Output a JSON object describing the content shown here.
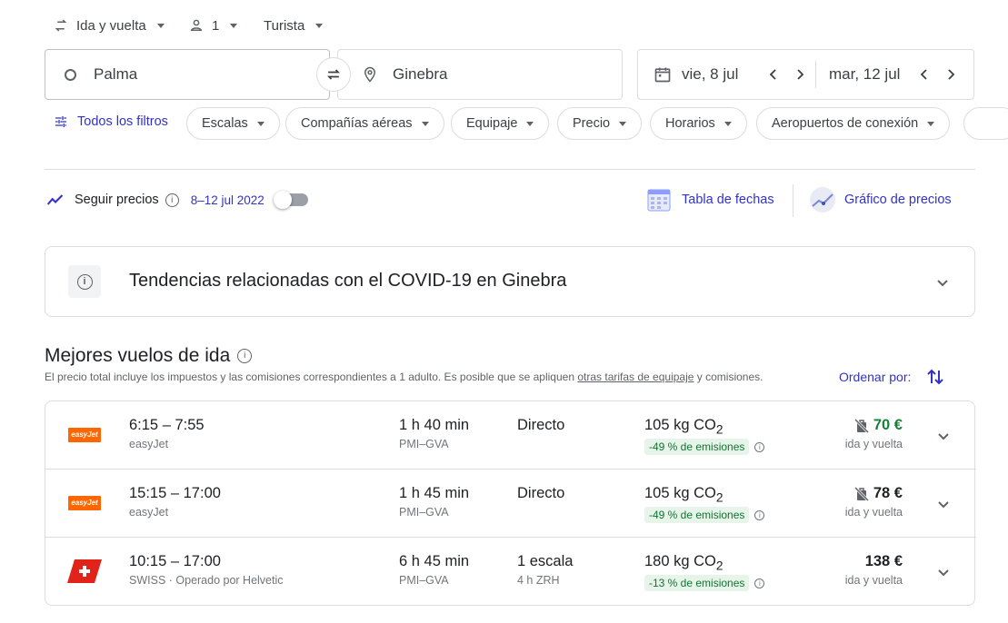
{
  "top": {
    "trip_type": "Ida y vuelta",
    "passengers": "1",
    "cabin_class": "Turista"
  },
  "search": {
    "origin": "Palma",
    "destination": "Ginebra",
    "departure_date": "vie, 8 jul",
    "return_date": "mar, 12 jul"
  },
  "filters": {
    "all_filters": "Todos los filtros",
    "chips": [
      "Escalas",
      "Compañías aéreas",
      "Equipaje",
      "Precio",
      "Horarios",
      "Aeropuertos de conexión"
    ]
  },
  "tracking": {
    "label": "Seguir precios",
    "date_range": "8–12 jul 2022",
    "toggle_on": false
  },
  "views": {
    "date_grid": "Tabla de fechas",
    "price_graph": "Gráfico de precios"
  },
  "covid": {
    "text": "Tendencias relacionadas con el COVID-19 en Ginebra"
  },
  "results": {
    "heading": "Mejores vuelos de ida",
    "disclaimer_before": "El precio total incluye los impuestos y las comisiones correspondientes a 1 adulto. Es posible que se apliquen ",
    "disclaimer_link": "otras tarifas de equipaje",
    "disclaimer_after": " y comisiones.",
    "sort_label": "Ordenar por:"
  },
  "flights": [
    {
      "times": "6:15 – 7:55",
      "airline": "easyJet",
      "logo": "easyJet",
      "duration": "1 h 40 min",
      "route": "PMI–GVA",
      "stops": "Directo",
      "stop_detail": "",
      "co2": "105 kg CO",
      "co2_sub": "2",
      "emissions": "-49 % de emisiones",
      "price": "70 €",
      "price_note": "ida y vuelta",
      "price_color": "#188038",
      "no_bag": true
    },
    {
      "times": "15:15 – 17:00",
      "airline": "easyJet",
      "logo": "easyJet",
      "duration": "1 h 45 min",
      "route": "PMI–GVA",
      "stops": "Directo",
      "stop_detail": "",
      "co2": "105 kg CO",
      "co2_sub": "2",
      "emissions": "-49 % de emisiones",
      "price": "78 €",
      "price_note": "ida y vuelta",
      "price_color": "#202124",
      "no_bag": true
    },
    {
      "times": "10:15 – 17:00",
      "airline": "SWISS · Operado por Helvetic",
      "logo": "swiss",
      "duration": "6 h 45 min",
      "route": "PMI–GVA",
      "stops": "1 escala",
      "stop_detail": "4 h ZRH",
      "co2": "180 kg CO",
      "co2_sub": "2",
      "emissions": "-13 % de emisiones",
      "price": "138 €",
      "price_note": "ida y vuelta",
      "price_color": "#202124",
      "no_bag": false
    }
  ],
  "colors": {
    "accent": "#3232c8",
    "green": "#188038",
    "easyjet": "#ff6600",
    "swiss": "#e2231a"
  }
}
